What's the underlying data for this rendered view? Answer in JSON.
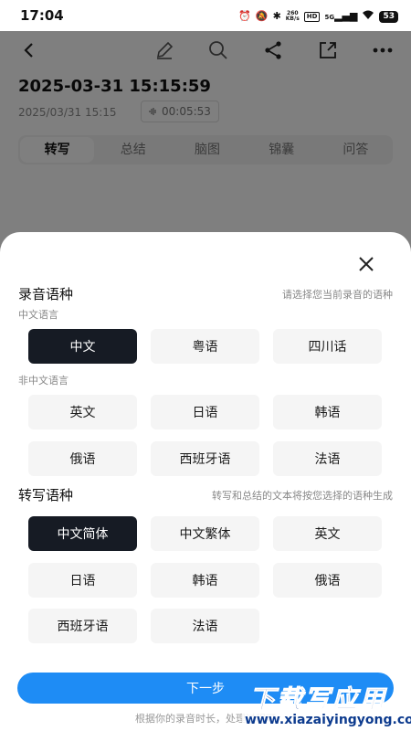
{
  "status_bar": {
    "time": "17:04",
    "net_speed_value": "260",
    "net_speed_unit": "KB/s",
    "hd_label": "HD",
    "signal_label": "5G",
    "battery": "53"
  },
  "app": {
    "recording_title": "2025-03-31 15:15:59",
    "recording_date": "2025/03/31 15:15",
    "recording_duration": "00:05:53",
    "tabs": [
      {
        "label": "转写",
        "active": true
      },
      {
        "label": "总结",
        "active": false
      },
      {
        "label": "脑图",
        "active": false
      },
      {
        "label": "锦囊",
        "active": false
      },
      {
        "label": "问答",
        "active": false
      }
    ]
  },
  "sheet": {
    "recording_language": {
      "title": "录音语种",
      "hint": "请选择您当前录音的语种",
      "chinese_group_label": "中文语言",
      "chinese_options": [
        {
          "label": "中文",
          "selected": true
        },
        {
          "label": "粤语",
          "selected": false
        },
        {
          "label": "四川话",
          "selected": false
        }
      ],
      "other_group_label": "非中文语言",
      "other_options": [
        {
          "label": "英文",
          "selected": false
        },
        {
          "label": "日语",
          "selected": false
        },
        {
          "label": "韩语",
          "selected": false
        },
        {
          "label": "俄语",
          "selected": false
        },
        {
          "label": "西班牙语",
          "selected": false
        },
        {
          "label": "法语",
          "selected": false
        }
      ]
    },
    "transcription_language": {
      "title": "转写语种",
      "hint": "转写和总结的文本将按您选择的语种生成",
      "options": [
        {
          "label": "中文简体",
          "selected": true
        },
        {
          "label": "中文繁体",
          "selected": false
        },
        {
          "label": "英文",
          "selected": false
        },
        {
          "label": "日语",
          "selected": false
        },
        {
          "label": "韩语",
          "selected": false
        },
        {
          "label": "俄语",
          "selected": false
        },
        {
          "label": "西班牙语",
          "selected": false
        },
        {
          "label": "法语",
          "selected": false
        }
      ]
    },
    "next_button": "下一步",
    "footnote": "根据你的录音时长，处理过程可"
  },
  "watermark": {
    "line1": "下载写应用",
    "line2": "www.xiazaiyingyong.com"
  },
  "colors": {
    "selected_bg": "#161b24",
    "option_bg": "#f5f5f5",
    "primary_button": "#1e8cf5",
    "overlay": "rgba(0,0,0,0.5)"
  },
  "icons": {
    "toolbar": [
      "back-arrow-icon",
      "edit-pencil-icon",
      "search-icon",
      "share-icon",
      "export-icon",
      "more-dots-icon"
    ],
    "sheet": [
      "close-icon"
    ]
  }
}
